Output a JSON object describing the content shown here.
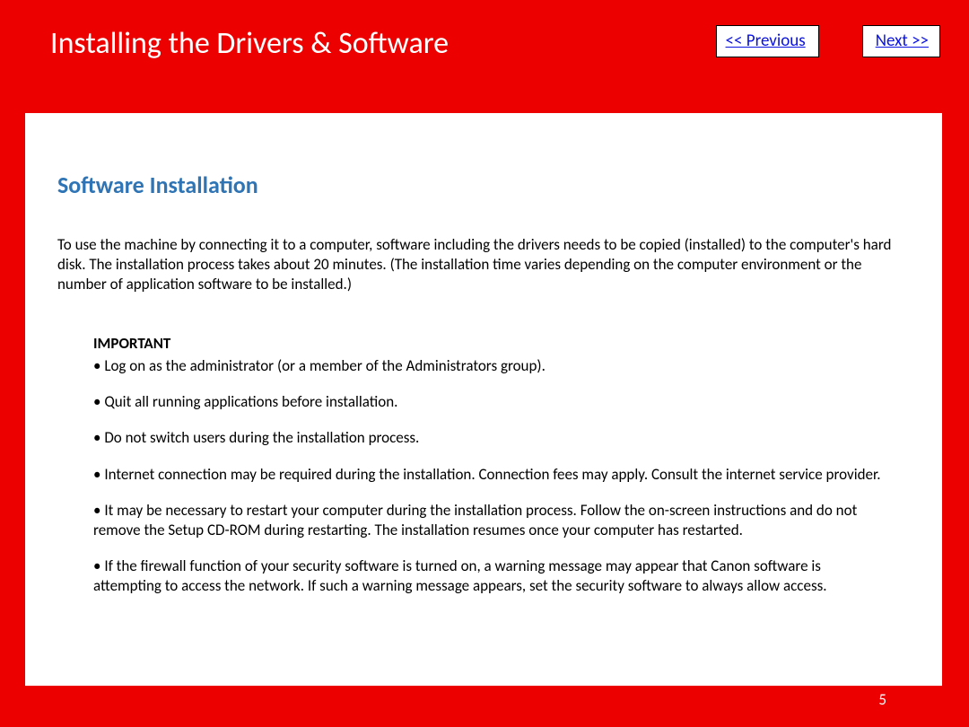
{
  "header": {
    "title": "Installing  the Drivers & Software",
    "nav": {
      "previous": " << Previous",
      "next": "Next >>"
    }
  },
  "section": {
    "title": "Software Installation",
    "intro": "To use the machine by connecting it to a computer, software including the drivers needs to be copied (installed) to the computer's hard disk. The installation process takes about 20 minutes. (The installation time varies depending on the computer environment or the number of application software to be installed.)"
  },
  "important": {
    "label": "IMPORTANT",
    "items": [
      "Log on as the administrator (or a member of the Administrators group).",
      "Quit all running applications before installation.",
      "Do not switch users during the installation process.",
      "Internet connection may be required during the installation. Connection fees may apply. Consult the internet service provider.",
      "It may be necessary to restart your computer during the installation process. Follow the on-screen instructions and do not remove the Setup CD-ROM during restarting. The installation resumes once your computer has restarted.",
      "If the firewall function of your security software is turned on, a warning message may appear that Canon software is attempting to access the network. If such a warning message appears, set the security software to always allow access."
    ]
  },
  "footer": {
    "page": "5"
  }
}
